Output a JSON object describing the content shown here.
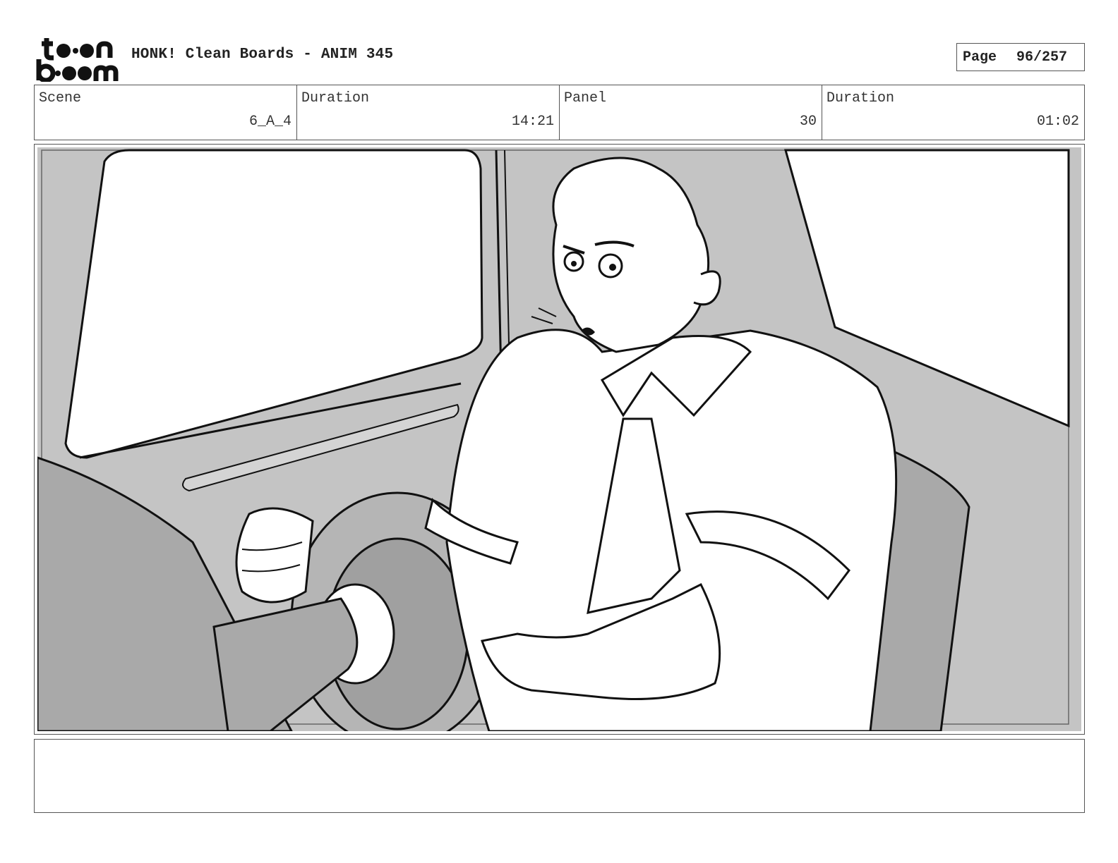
{
  "header": {
    "logo_text": "toon boom",
    "title": "HONK! Clean Boards - ANIM 345",
    "page_label": "Page",
    "page_number": "96/257"
  },
  "info": {
    "scene_label": "Scene",
    "scene_value": "6_A_4",
    "scene_duration_label": "Duration",
    "scene_duration_value": "14:21",
    "panel_label": "Panel",
    "panel_value": "30",
    "panel_duration_label": "Duration",
    "panel_duration_value": "01:02"
  },
  "panel": {
    "colors": {
      "background": "#c4c4c4",
      "window": "#ffffff",
      "dark_gray": "#a9a9a9",
      "mid_gray": "#b5b5b5",
      "line": "#111111"
    }
  },
  "notes": {
    "text": ""
  }
}
